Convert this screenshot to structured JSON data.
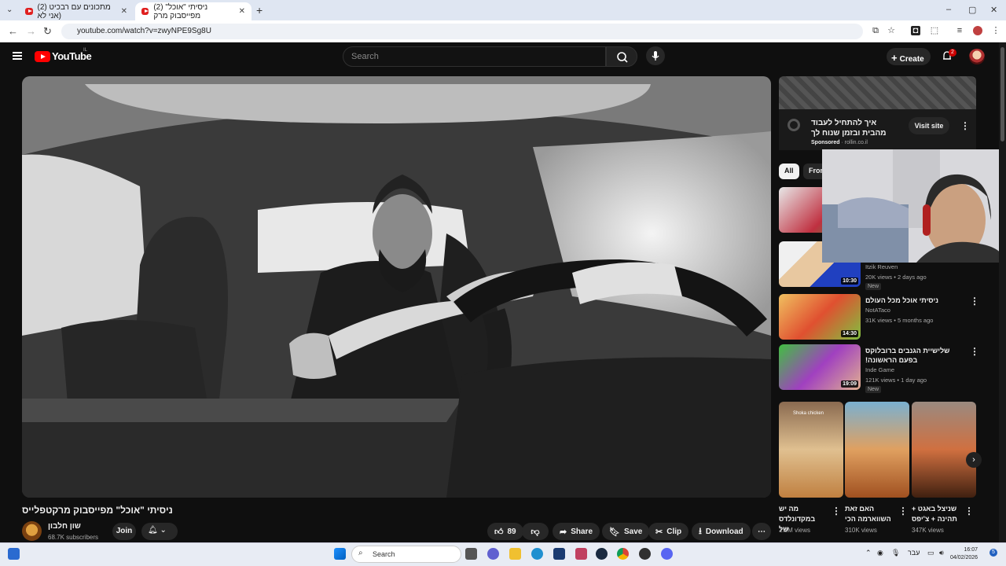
{
  "browser": {
    "tabs": [
      {
        "label": "(2) מתכונים עם רבכיט (אני לא"
      },
      {
        "label": "(2) ניסיתי \"אוכל\" מפייסבוק מרק"
      }
    ],
    "new_tab": "+",
    "url": "youtube.com/watch?v=zwyNPE9Sg8U"
  },
  "youtube": {
    "logo_text": "YouTube",
    "country_code": "IL",
    "search_placeholder": "Search",
    "create_label": "Create",
    "notification_count": "2"
  },
  "video": {
    "title": "ניסיתי \"אוכל\" מפייסבוק מרקטפלייס",
    "channel": "שון חלבון",
    "subscribers": "68.7K subscribers",
    "join_label": "Join",
    "like_count": "89",
    "share_label": "Share",
    "save_label": "Save",
    "clip_label": "Clip",
    "download_label": "Download"
  },
  "ad": {
    "title": "איך להתחיל לעבוד מהבית ובזמן שנוח לך",
    "sponsored": "Sponsored",
    "domain": "rollin.co.il",
    "visit_label": "Visit site"
  },
  "chips": [
    "All",
    "From"
  ],
  "related": [
    {
      "title": "",
      "channel": "",
      "meta": "",
      "duration": "",
      "badge": ""
    },
    {
      "title": "",
      "channel": "Itzik Reuven",
      "meta": "20K views • 2 days ago",
      "duration": "10:30",
      "badge": "New"
    },
    {
      "title": "ניסיתי אוכל מכל העולם",
      "channel": "NotATaco",
      "meta": "31K views • 5 months ago",
      "duration": "14:30",
      "badge": ""
    },
    {
      "title": "שלישיית הגנבים ברובלוקס בפעם הראשונה!",
      "channel": "Inde Game",
      "meta": "121K views • 1 day ago",
      "duration": "19:09",
      "badge": "New"
    }
  ],
  "shorts": [
    {
      "title": "מה יש במקדונלדס של",
      "views": "1.2M views",
      "overlay": "Shoka chicken"
    },
    {
      "title": "האם זאת השווארמה הכי",
      "views": "310K views"
    },
    {
      "title": "שניצל באגט + תהינה + צ'יפס",
      "views": "347K views"
    }
  ],
  "taskbar": {
    "search_label": "Search",
    "lang": "עבר",
    "time": "16:07",
    "date": "04/02/2026"
  },
  "colors": {
    "bg": "#0f0f0f",
    "yt_red": "#ff0000",
    "pill": "#272727",
    "text": "#f1f1f1",
    "secondary": "#aaaaaa"
  }
}
